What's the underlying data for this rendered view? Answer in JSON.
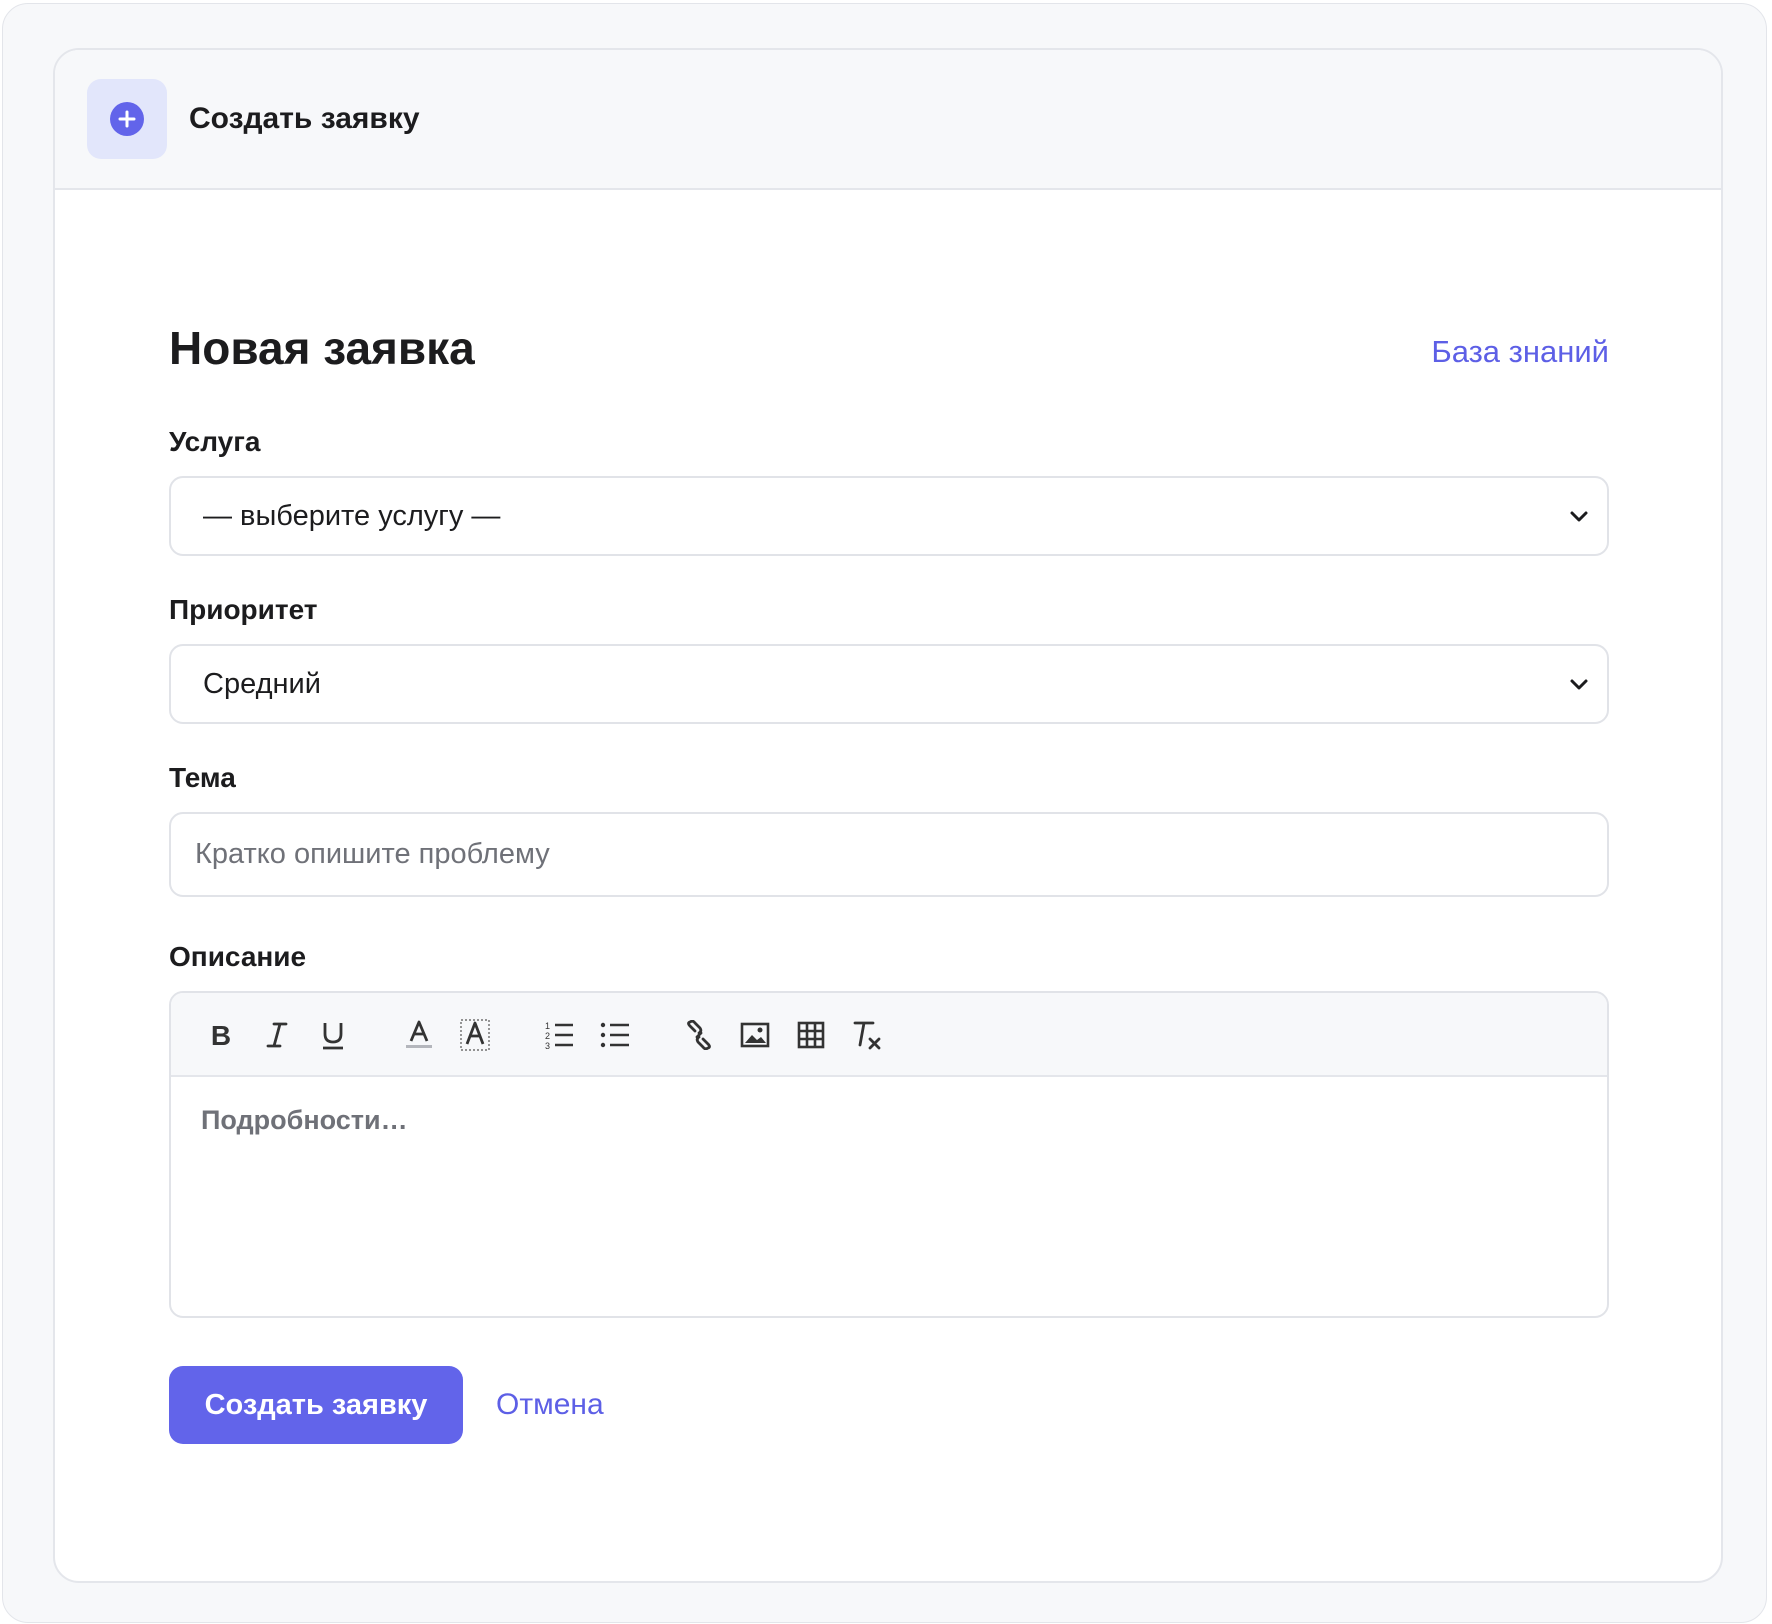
{
  "header": {
    "title": "Создать заявку",
    "icon": "plus-circle-icon",
    "accent_color": "#6264ea"
  },
  "form": {
    "title": "Новая заявка",
    "knowledge_base_link": "База знаний",
    "service": {
      "label": "Услуга",
      "selected": "— выберите услугу —"
    },
    "priority": {
      "label": "Приоритет",
      "selected": "Средний"
    },
    "subject": {
      "label": "Тема",
      "placeholder": "Кратко опишите проблему",
      "value": ""
    },
    "description": {
      "label": "Описание",
      "placeholder": "Подробности…",
      "toolbar": [
        "bold-icon",
        "italic-icon",
        "underline-icon",
        "text-color-icon",
        "background-color-icon",
        "ordered-list-icon",
        "bullet-list-icon",
        "link-icon",
        "image-icon",
        "table-icon",
        "clear-format-icon"
      ]
    },
    "submit_label": "Создать заявку",
    "cancel_label": "Отмена"
  }
}
